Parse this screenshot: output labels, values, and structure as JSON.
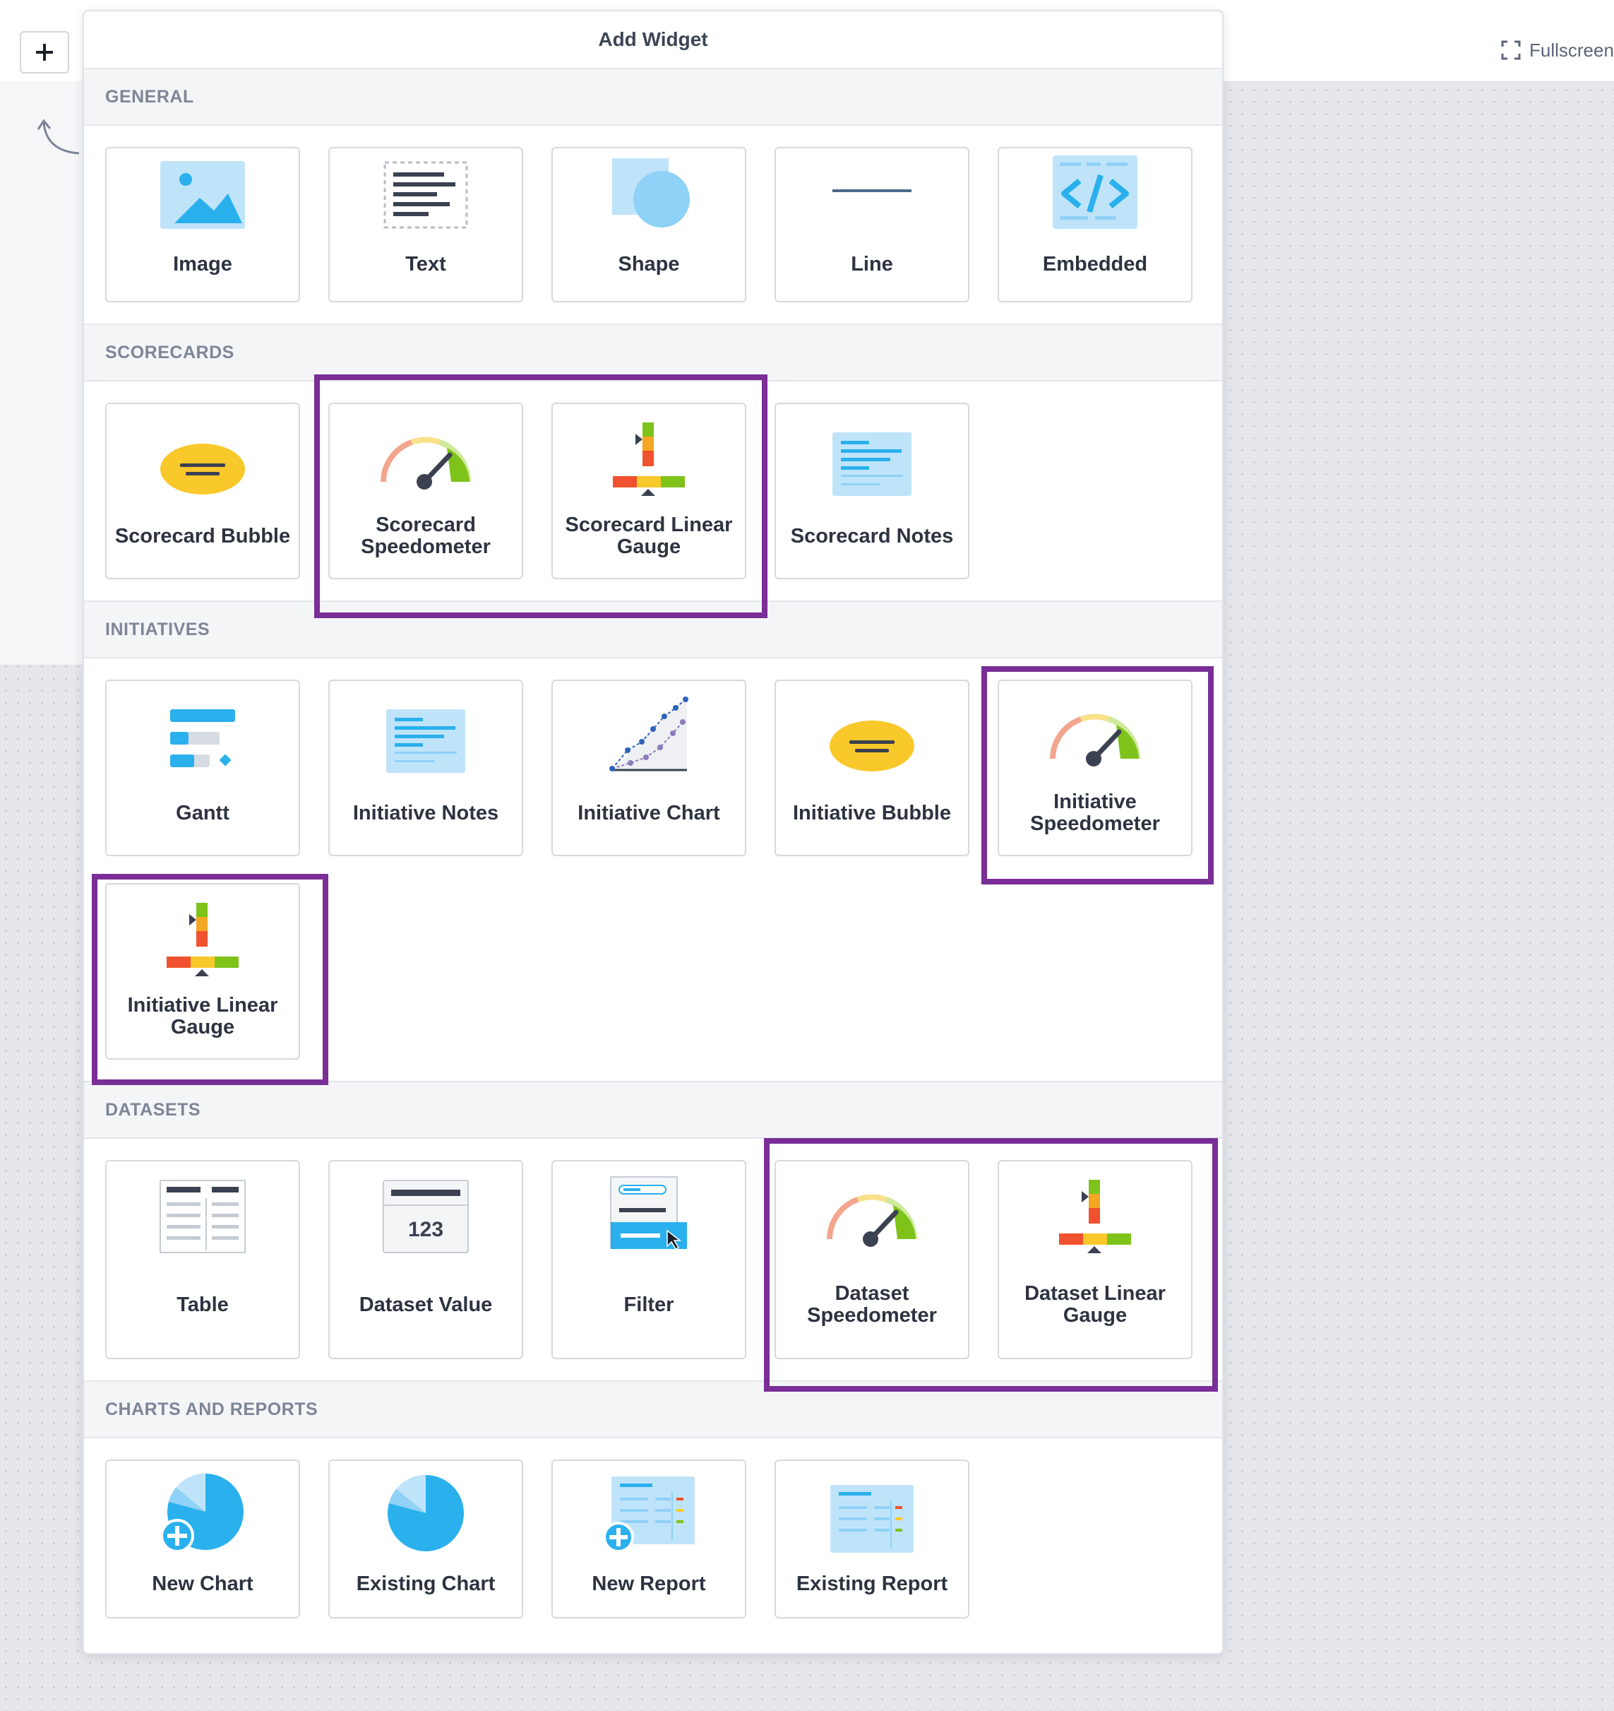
{
  "window": {
    "fullscreen_label": "Fullscreen"
  },
  "panel": {
    "title": "Add Widget"
  },
  "sections": {
    "general": {
      "title": "GENERAL",
      "tiles": [
        "Image",
        "Text",
        "Shape",
        "Line",
        "Embedded"
      ]
    },
    "scorecards": {
      "title": "SCORECARDS",
      "tiles": [
        "Scorecard Bubble",
        "Scorecard Speedometer",
        "Scorecard Linear Gauge",
        "Scorecard Notes"
      ]
    },
    "initiatives": {
      "title": "INITIATIVES",
      "tiles": [
        "Gantt",
        "Initiative Notes",
        "Initiative Chart",
        "Initiative Bubble",
        "Initiative Speedometer",
        "Initiative Linear Gauge"
      ]
    },
    "datasets": {
      "title": "DATASETS",
      "tiles": [
        "Table",
        "Dataset Value",
        "Filter",
        "Dataset Speedometer",
        "Dataset Linear Gauge"
      ],
      "dataset_value_text": "123"
    },
    "charts": {
      "title": "CHARTS AND REPORTS",
      "tiles": [
        "New Chart",
        "Existing Chart",
        "New Report",
        "Existing Report"
      ]
    }
  },
  "colors": {
    "highlight": "#7a2e96",
    "accent_blue": "#2ab0ec",
    "gauge_green": "#7ec31a",
    "bubble_yellow": "#f9c82a"
  }
}
